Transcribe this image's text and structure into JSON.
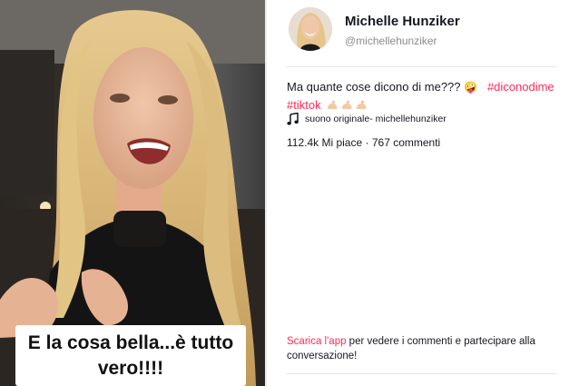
{
  "video": {
    "caption_line1": "E la cosa bella...è tutto",
    "caption_line2": "vero!!!!"
  },
  "author": {
    "display_name": "Michelle Hunziker",
    "handle": "@michellehunziker"
  },
  "post": {
    "description_text": "Ma quante cose dicono di me???",
    "description_emoji": "🤪",
    "hashtags": [
      "#diconodime",
      "#tiktok"
    ],
    "trailing_emoji": [
      "muscle-icon",
      "muscle-icon",
      "muscle-icon"
    ],
    "music_label": "suono originale- michellehunziker",
    "likes": "112.4k Mi piace",
    "separator": "·",
    "comments": "767 commenti"
  },
  "cta": {
    "link_text": "Scarica l'app",
    "rest_text": " per vedere i commenti e partecipare alla conversazione!"
  },
  "colors": {
    "accent": "#fe2c55",
    "text": "#161823",
    "muted": "#8a8b91"
  }
}
